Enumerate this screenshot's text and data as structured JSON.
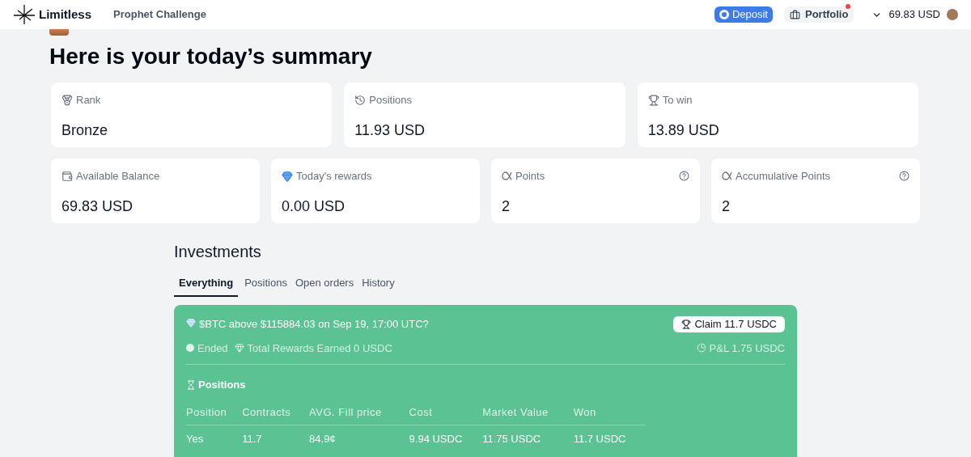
{
  "header": {
    "brand": "Limitless",
    "nav": "Prophet Challenge",
    "deposit": "Deposit",
    "portfolio": {
      "label": "Portfolio",
      "notification": true
    },
    "balance": "69.83 USD"
  },
  "greeting": {
    "line2": "Here is your today’s summary"
  },
  "stats_top": [
    {
      "kind": "rank",
      "label": "Rank",
      "value": "Bronze"
    },
    {
      "kind": "history",
      "label": "Positions",
      "value": "11.93 USD"
    },
    {
      "kind": "trophy",
      "label": "To win",
      "value": "13.89 USD"
    }
  ],
  "stats_bottom": [
    {
      "kind": "wallet",
      "label": "Available Balance",
      "value": "69.83 USD",
      "help": false
    },
    {
      "kind": "diamond",
      "label": "Today's rewards",
      "value": "0.00 USD",
      "help": false
    },
    {
      "kind": "alpha",
      "label": "Points",
      "value": "2",
      "help": true
    },
    {
      "kind": "alpha",
      "label": "Accumulative Points",
      "value": "2",
      "help": true
    }
  ],
  "investments": {
    "title": "Investments",
    "tabs": [
      {
        "label": "Everything",
        "selected": true
      },
      {
        "label": "Positions",
        "selected": false
      },
      {
        "label": "Open orders",
        "selected": false
      },
      {
        "label": "History",
        "selected": false
      }
    ],
    "market": {
      "question": "$BTC above $115884.03 on Sep 19, 17:00 UTC?",
      "claim": "Claim 11.7 USDC",
      "status": "Ended",
      "rewards": "Total Rewards Earned 0 USDC",
      "pnl": "P&L 1.75 USDC",
      "positions_title": "Positions",
      "columns": [
        "Position",
        "Contracts",
        "AVG. Fill price",
        "Cost",
        "Market Value",
        "Won"
      ],
      "rows": [
        [
          "Yes",
          "11.7",
          "84.9¢",
          "9.94 USDC",
          "11.75 USDC",
          "11.7 USDC"
        ]
      ]
    }
  }
}
